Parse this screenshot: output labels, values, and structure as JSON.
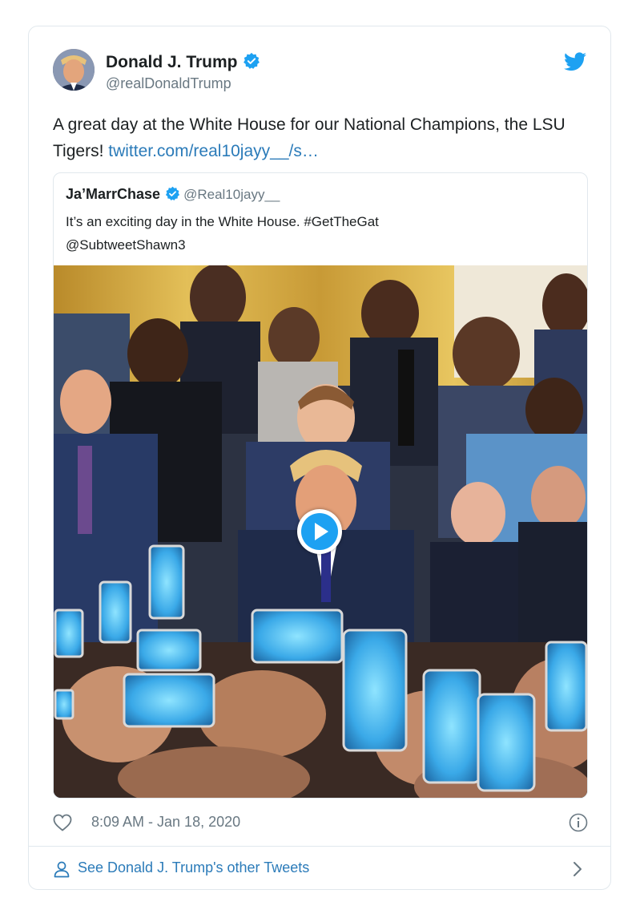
{
  "tweet": {
    "author_name": "Donald J. Trump",
    "author_handle": "@realDonaldTrump",
    "text": "A great day at the White House for our National Champions, the LSU Tigers! ",
    "link_text": "twitter.com/real10jayy__/s…",
    "timestamp": "8:09 AM - Jan 18, 2020"
  },
  "quote": {
    "author_name": "Ja’MarrChase",
    "author_handle": "@Real10jayy__",
    "text_line1": "It’s an exciting day in the White House. #GetTheGat",
    "text_line2": "@SubtweetShawn3"
  },
  "footer": {
    "label": "See Donald J. Trump's other Tweets"
  },
  "icons": {
    "verified": "verified-badge-icon",
    "brand": "twitter-bird-icon",
    "like": "heart-icon",
    "info": "info-icon",
    "profile": "person-icon",
    "more": "chevron-right-icon",
    "play": "play-icon"
  },
  "colors": {
    "twitter_blue": "#1da1f2",
    "link_blue": "#2b7bb9",
    "secondary_text": "#697882",
    "border": "#e1e8ed"
  }
}
